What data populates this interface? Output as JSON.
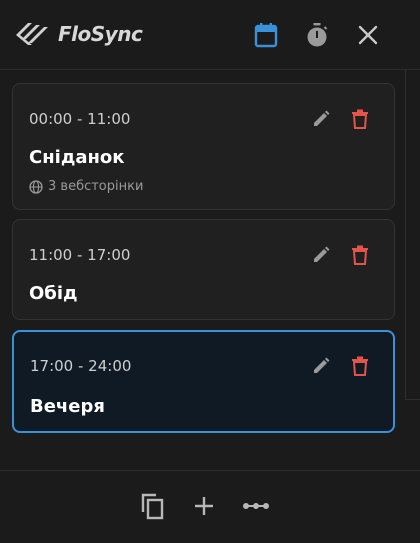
{
  "app": {
    "name": "FloSync"
  },
  "header": {
    "icons": [
      "calendar-icon",
      "timer-icon",
      "close-icon"
    ],
    "active_color": "#3b91d8"
  },
  "slots": [
    {
      "time": "00:00 - 11:00",
      "name": "Сніданок",
      "sub": "3 вебсторінки",
      "active": false
    },
    {
      "time": "11:00 - 17:00",
      "name": "Обід",
      "active": false
    },
    {
      "time": "17:00 - 24:00",
      "name": "Вечеря",
      "active": true
    }
  ],
  "colors": {
    "delete": "#e5534b",
    "edit": "#9a9a9a",
    "accent": "#3b91d8"
  },
  "footer": {
    "icons": [
      "copy-icon",
      "plus-icon",
      "more-icon"
    ]
  }
}
